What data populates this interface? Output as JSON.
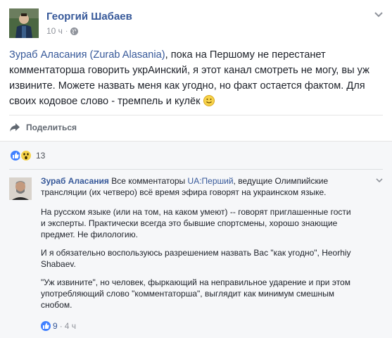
{
  "post": {
    "author": "Георгий Шабаев",
    "time": "10 ч",
    "time_sep": "·",
    "text_mention": "Зураб Аласания (Zurab Alasania)",
    "text_body": ", пока на Першому не перестанет комментаторша говорить укрАинский, я этот канал смотреть не могу, вы уж извините. Можете назвать меня как угодно, но факт остается фактом. Для своих кодовое слово - тремпель и кулёк "
  },
  "actions": {
    "share_label": "Поделиться"
  },
  "reactions": {
    "count": "13"
  },
  "comment": {
    "author": "Зураб Аласания",
    "p1_a": " Все комментаторы ",
    "p1_link": "UA:Перший",
    "p1_b": ", ведущие Олимпийские трансляции (их четверо) всё время эфира говорят на украинском языке.",
    "p2": "На русском языке (или на том, на каком умеют) -- говорят приглашенные гости и эксперты. Практически всегда это бывшие спортсмены, хорошо знающие предмет. Не филологию.",
    "p3": "И я обязательно воспользуюсь разрешением назвать Вас \"как угодно\", Heorhiy Shabaev.",
    "p4": "\"Уж извините\", но человек, фыркающий на неправильное ударение и при этом употребляющий слово \"комментаторша\", выглядит как минимум смешным снобом.",
    "likes": "9",
    "sep": "·",
    "time": "4 ч"
  }
}
